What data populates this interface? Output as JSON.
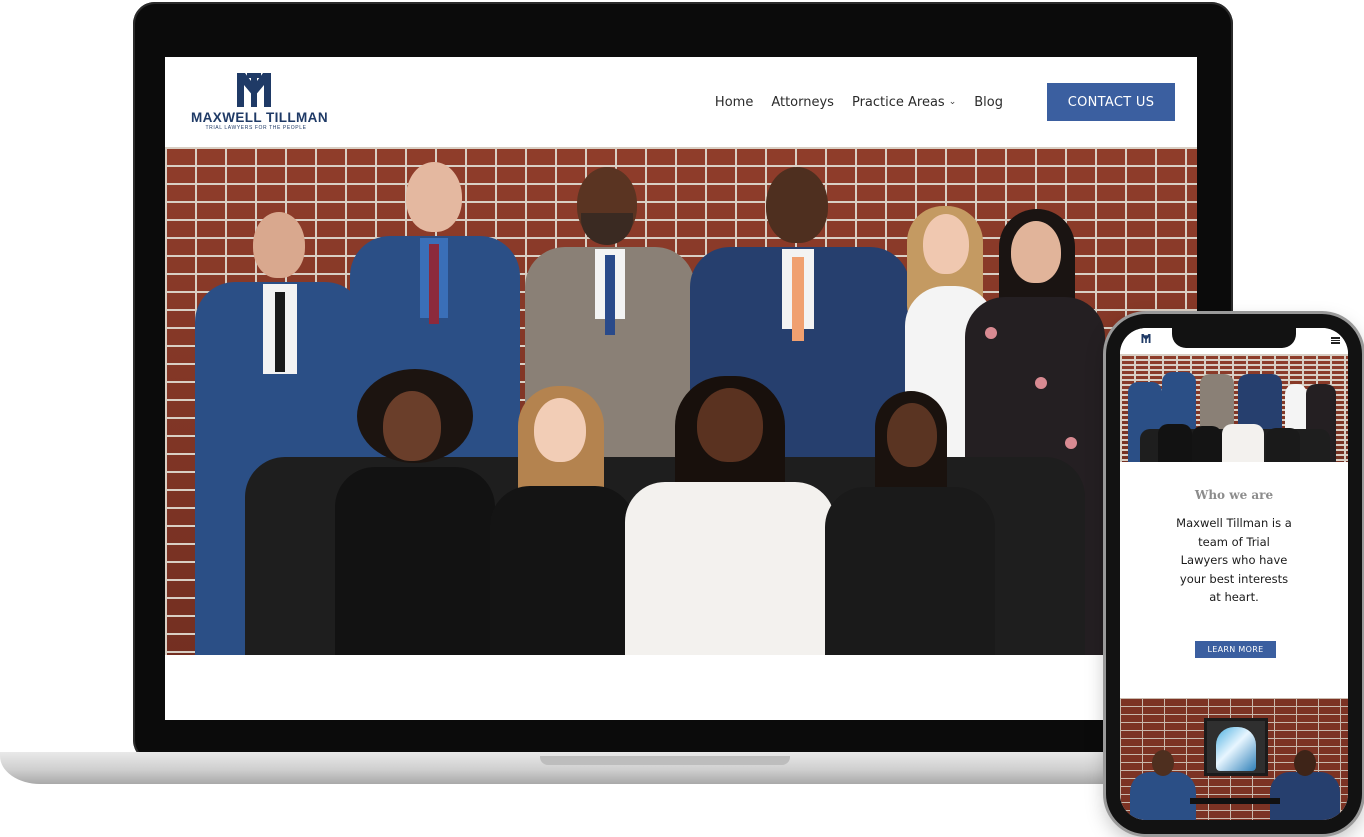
{
  "laptop": {
    "logo": {
      "name": "MAXWELL TILLMAN",
      "tagline": "TRIAL LAWYERS FOR THE PEOPLE"
    },
    "nav": {
      "items": [
        {
          "label": "Home"
        },
        {
          "label": "Attorneys"
        },
        {
          "label": "Practice Areas",
          "has_dropdown": true,
          "icon": "chevron-down-icon"
        },
        {
          "label": "Blog"
        }
      ],
      "cta_label": "CONTACT US"
    },
    "hero": {
      "image": "team-photo-brick-wall"
    }
  },
  "phone": {
    "header_icon": "hamburger-menu-icon",
    "who_title": "Who we are",
    "who_text": "Maxwell Tillman is a team of Trial Lawyers who have your best interests at heart.",
    "cta_label": "LEARN MORE"
  },
  "colors": {
    "brand_navy": "#1f3a66",
    "button_blue": "#3b5fa0",
    "brick": "#7c3324"
  }
}
